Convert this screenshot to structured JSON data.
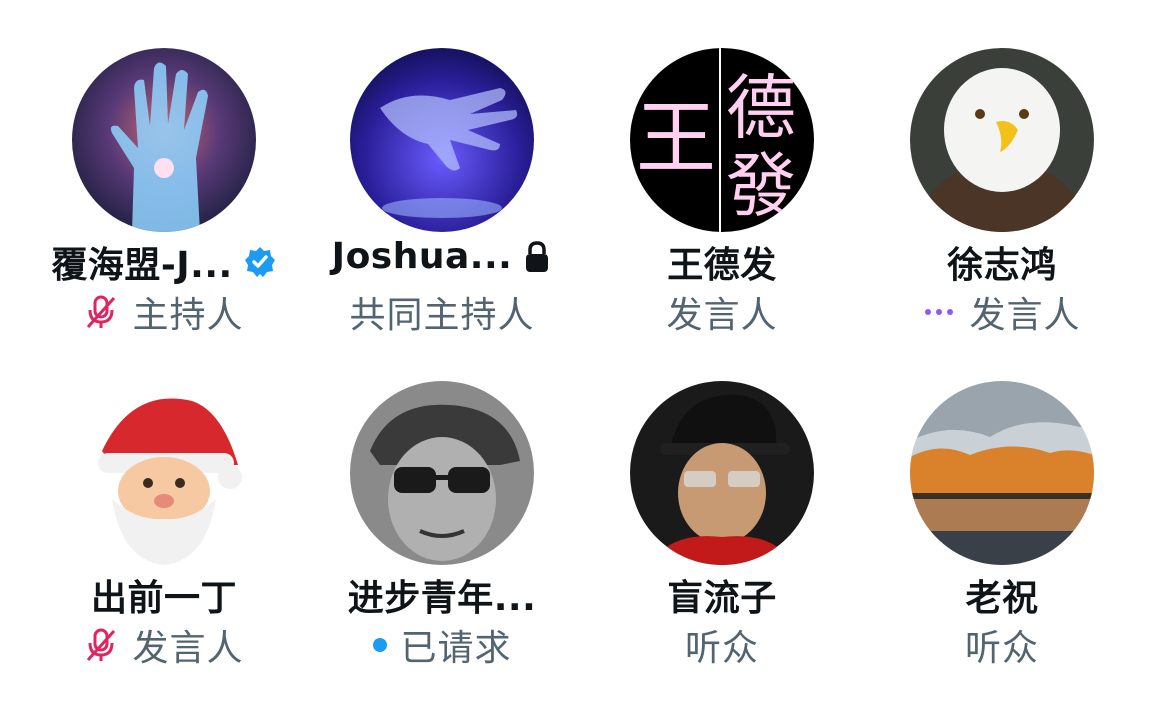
{
  "participants": [
    {
      "name": "覆海盟-J...",
      "role": "主持人",
      "verified": true,
      "muted": true,
      "avatar_icon": "galaxy-hand-icon"
    },
    {
      "name": "Joshua...",
      "role": "共同主持人",
      "locked": true,
      "avatar_icon": "cosmic-hand-icon"
    },
    {
      "name": "王德发",
      "role": "发言人",
      "avatar_icon": "calligraphy-icon",
      "avatar_text": [
        "王",
        "德",
        "發"
      ]
    },
    {
      "name": "徐志鸿",
      "role": "发言人",
      "speaking": true,
      "avatar_icon": "eagle-icon"
    },
    {
      "name": "出前一丁",
      "role": "发言人",
      "muted": true,
      "avatar_icon": "santa-icon"
    },
    {
      "name": "进步青年...",
      "role": "已请求",
      "requested": true,
      "avatar_icon": "sunglasses-man-icon"
    },
    {
      "name": "盲流子",
      "role": "听众",
      "avatar_icon": "hat-man-icon"
    },
    {
      "name": "老祝",
      "role": "听众",
      "avatar_icon": "landscape-icon"
    }
  ],
  "colors": {
    "verified_blue": "#1d9bf0",
    "muted_pink": "#e0245e",
    "speaking_purple": "#8a5cf5",
    "request_blue": "#1d9bf0",
    "role_gray": "#536471",
    "name_black": "#0f1419"
  }
}
